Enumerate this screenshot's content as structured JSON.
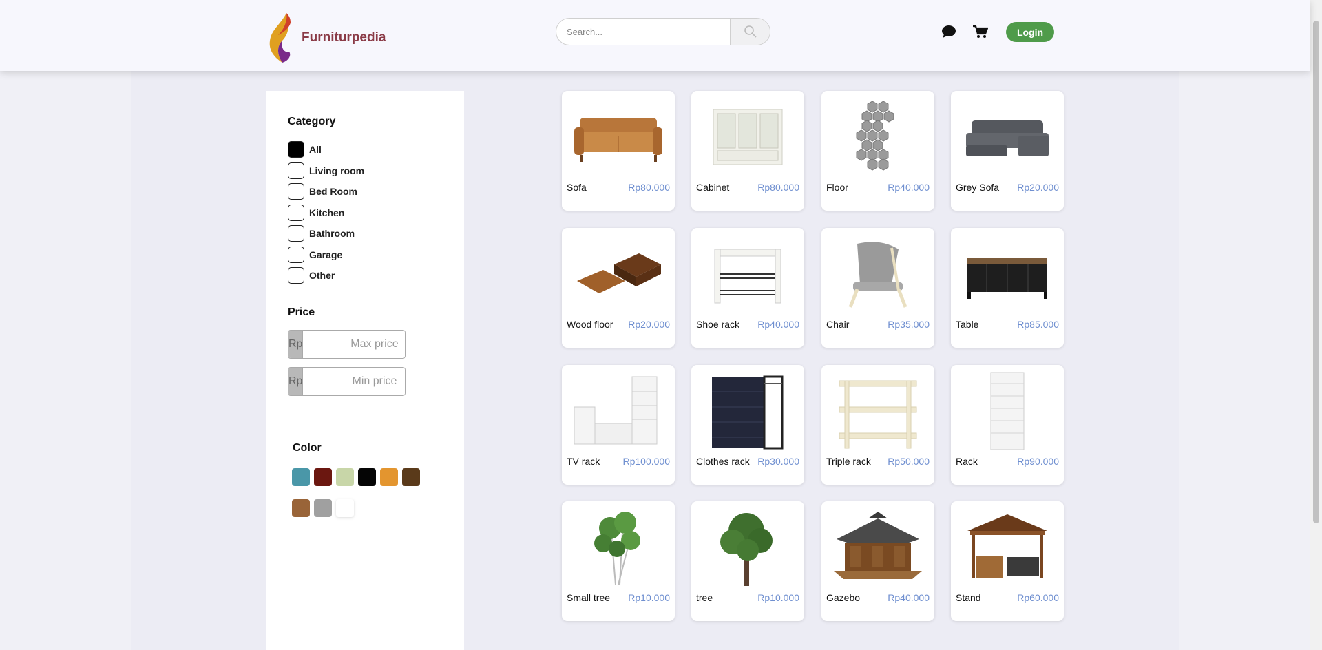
{
  "header": {
    "brand": "Furniturpedia",
    "search_placeholder": "Search...",
    "login_label": "Login"
  },
  "sidebar": {
    "category_title": "Category",
    "categories": [
      {
        "label": "All",
        "checked": true
      },
      {
        "label": "Living room",
        "checked": false
      },
      {
        "label": "Bed Room",
        "checked": false
      },
      {
        "label": "Kitchen",
        "checked": false
      },
      {
        "label": "Bathroom",
        "checked": false
      },
      {
        "label": "Garage",
        "checked": false
      },
      {
        "label": "Other",
        "checked": false
      }
    ],
    "price_title": "Price",
    "currency": "Rp",
    "max_placeholder": "Max price",
    "min_placeholder": "Min price",
    "color_title": "Color",
    "colors": [
      "#4a97a8",
      "#6b1710",
      "#c8d6a8",
      "#050505",
      "#e3952f",
      "#5a3a1a",
      "#996438",
      "#a0a0a0",
      "#ffffff"
    ]
  },
  "products": [
    {
      "name": "Sofa",
      "price": "Rp80.000",
      "icon": "sofa"
    },
    {
      "name": "Cabinet",
      "price": "Rp80.000",
      "icon": "cabinet"
    },
    {
      "name": "Floor",
      "price": "Rp40.000",
      "icon": "hex-tiles"
    },
    {
      "name": "Grey Sofa",
      "price": "Rp20.000",
      "icon": "grey-sofa"
    },
    {
      "name": "Wood floor",
      "price": "Rp20.000",
      "icon": "wood-floor"
    },
    {
      "name": "Shoe rack",
      "price": "Rp40.000",
      "icon": "shoe-rack"
    },
    {
      "name": "Chair",
      "price": "Rp35.000",
      "icon": "chair"
    },
    {
      "name": "Table",
      "price": "Rp85.000",
      "icon": "tv-table"
    },
    {
      "name": "TV rack",
      "price": "Rp100.000",
      "icon": "tv-rack"
    },
    {
      "name": "Clothes rack",
      "price": "Rp30.000",
      "icon": "clothes-rack"
    },
    {
      "name": "Triple rack",
      "price": "Rp50.000",
      "icon": "triple-rack"
    },
    {
      "name": "Rack",
      "price": "Rp90.000",
      "icon": "bookshelf"
    },
    {
      "name": "Small tree",
      "price": "Rp10.000",
      "icon": "small-tree"
    },
    {
      "name": "tree",
      "price": "Rp10.000",
      "icon": "tree"
    },
    {
      "name": "Gazebo",
      "price": "Rp40.000",
      "icon": "gazebo"
    },
    {
      "name": "Stand",
      "price": "Rp60.000",
      "icon": "stand"
    }
  ]
}
